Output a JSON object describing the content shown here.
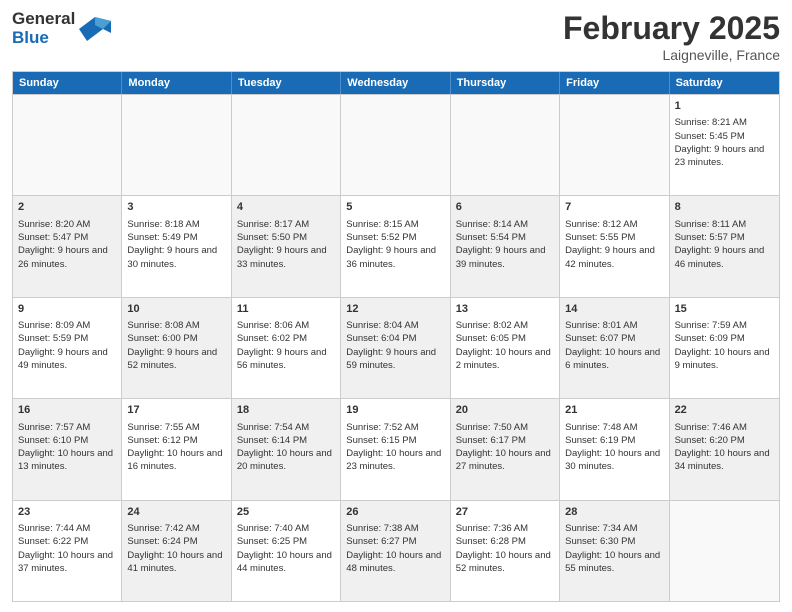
{
  "logo": {
    "general": "General",
    "blue": "Blue"
  },
  "header": {
    "month": "February 2025",
    "location": "Laigneville, France"
  },
  "weekdays": [
    "Sunday",
    "Monday",
    "Tuesday",
    "Wednesday",
    "Thursday",
    "Friday",
    "Saturday"
  ],
  "weeks": [
    [
      {
        "day": "",
        "info": "",
        "shaded": false,
        "empty": true
      },
      {
        "day": "",
        "info": "",
        "shaded": false,
        "empty": true
      },
      {
        "day": "",
        "info": "",
        "shaded": false,
        "empty": true
      },
      {
        "day": "",
        "info": "",
        "shaded": false,
        "empty": true
      },
      {
        "day": "",
        "info": "",
        "shaded": false,
        "empty": true
      },
      {
        "day": "",
        "info": "",
        "shaded": false,
        "empty": true
      },
      {
        "day": "1",
        "info": "Sunrise: 8:21 AM\nSunset: 5:45 PM\nDaylight: 9 hours and 23 minutes.",
        "shaded": false,
        "empty": false
      }
    ],
    [
      {
        "day": "2",
        "info": "Sunrise: 8:20 AM\nSunset: 5:47 PM\nDaylight: 9 hours and 26 minutes.",
        "shaded": true,
        "empty": false
      },
      {
        "day": "3",
        "info": "Sunrise: 8:18 AM\nSunset: 5:49 PM\nDaylight: 9 hours and 30 minutes.",
        "shaded": false,
        "empty": false
      },
      {
        "day": "4",
        "info": "Sunrise: 8:17 AM\nSunset: 5:50 PM\nDaylight: 9 hours and 33 minutes.",
        "shaded": true,
        "empty": false
      },
      {
        "day": "5",
        "info": "Sunrise: 8:15 AM\nSunset: 5:52 PM\nDaylight: 9 hours and 36 minutes.",
        "shaded": false,
        "empty": false
      },
      {
        "day": "6",
        "info": "Sunrise: 8:14 AM\nSunset: 5:54 PM\nDaylight: 9 hours and 39 minutes.",
        "shaded": true,
        "empty": false
      },
      {
        "day": "7",
        "info": "Sunrise: 8:12 AM\nSunset: 5:55 PM\nDaylight: 9 hours and 42 minutes.",
        "shaded": false,
        "empty": false
      },
      {
        "day": "8",
        "info": "Sunrise: 8:11 AM\nSunset: 5:57 PM\nDaylight: 9 hours and 46 minutes.",
        "shaded": true,
        "empty": false
      }
    ],
    [
      {
        "day": "9",
        "info": "Sunrise: 8:09 AM\nSunset: 5:59 PM\nDaylight: 9 hours and 49 minutes.",
        "shaded": false,
        "empty": false
      },
      {
        "day": "10",
        "info": "Sunrise: 8:08 AM\nSunset: 6:00 PM\nDaylight: 9 hours and 52 minutes.",
        "shaded": true,
        "empty": false
      },
      {
        "day": "11",
        "info": "Sunrise: 8:06 AM\nSunset: 6:02 PM\nDaylight: 9 hours and 56 minutes.",
        "shaded": false,
        "empty": false
      },
      {
        "day": "12",
        "info": "Sunrise: 8:04 AM\nSunset: 6:04 PM\nDaylight: 9 hours and 59 minutes.",
        "shaded": true,
        "empty": false
      },
      {
        "day": "13",
        "info": "Sunrise: 8:02 AM\nSunset: 6:05 PM\nDaylight: 10 hours and 2 minutes.",
        "shaded": false,
        "empty": false
      },
      {
        "day": "14",
        "info": "Sunrise: 8:01 AM\nSunset: 6:07 PM\nDaylight: 10 hours and 6 minutes.",
        "shaded": true,
        "empty": false
      },
      {
        "day": "15",
        "info": "Sunrise: 7:59 AM\nSunset: 6:09 PM\nDaylight: 10 hours and 9 minutes.",
        "shaded": false,
        "empty": false
      }
    ],
    [
      {
        "day": "16",
        "info": "Sunrise: 7:57 AM\nSunset: 6:10 PM\nDaylight: 10 hours and 13 minutes.",
        "shaded": true,
        "empty": false
      },
      {
        "day": "17",
        "info": "Sunrise: 7:55 AM\nSunset: 6:12 PM\nDaylight: 10 hours and 16 minutes.",
        "shaded": false,
        "empty": false
      },
      {
        "day": "18",
        "info": "Sunrise: 7:54 AM\nSunset: 6:14 PM\nDaylight: 10 hours and 20 minutes.",
        "shaded": true,
        "empty": false
      },
      {
        "day": "19",
        "info": "Sunrise: 7:52 AM\nSunset: 6:15 PM\nDaylight: 10 hours and 23 minutes.",
        "shaded": false,
        "empty": false
      },
      {
        "day": "20",
        "info": "Sunrise: 7:50 AM\nSunset: 6:17 PM\nDaylight: 10 hours and 27 minutes.",
        "shaded": true,
        "empty": false
      },
      {
        "day": "21",
        "info": "Sunrise: 7:48 AM\nSunset: 6:19 PM\nDaylight: 10 hours and 30 minutes.",
        "shaded": false,
        "empty": false
      },
      {
        "day": "22",
        "info": "Sunrise: 7:46 AM\nSunset: 6:20 PM\nDaylight: 10 hours and 34 minutes.",
        "shaded": true,
        "empty": false
      }
    ],
    [
      {
        "day": "23",
        "info": "Sunrise: 7:44 AM\nSunset: 6:22 PM\nDaylight: 10 hours and 37 minutes.",
        "shaded": false,
        "empty": false
      },
      {
        "day": "24",
        "info": "Sunrise: 7:42 AM\nSunset: 6:24 PM\nDaylight: 10 hours and 41 minutes.",
        "shaded": true,
        "empty": false
      },
      {
        "day": "25",
        "info": "Sunrise: 7:40 AM\nSunset: 6:25 PM\nDaylight: 10 hours and 44 minutes.",
        "shaded": false,
        "empty": false
      },
      {
        "day": "26",
        "info": "Sunrise: 7:38 AM\nSunset: 6:27 PM\nDaylight: 10 hours and 48 minutes.",
        "shaded": true,
        "empty": false
      },
      {
        "day": "27",
        "info": "Sunrise: 7:36 AM\nSunset: 6:28 PM\nDaylight: 10 hours and 52 minutes.",
        "shaded": false,
        "empty": false
      },
      {
        "day": "28",
        "info": "Sunrise: 7:34 AM\nSunset: 6:30 PM\nDaylight: 10 hours and 55 minutes.",
        "shaded": true,
        "empty": false
      },
      {
        "day": "",
        "info": "",
        "shaded": false,
        "empty": true
      }
    ]
  ]
}
